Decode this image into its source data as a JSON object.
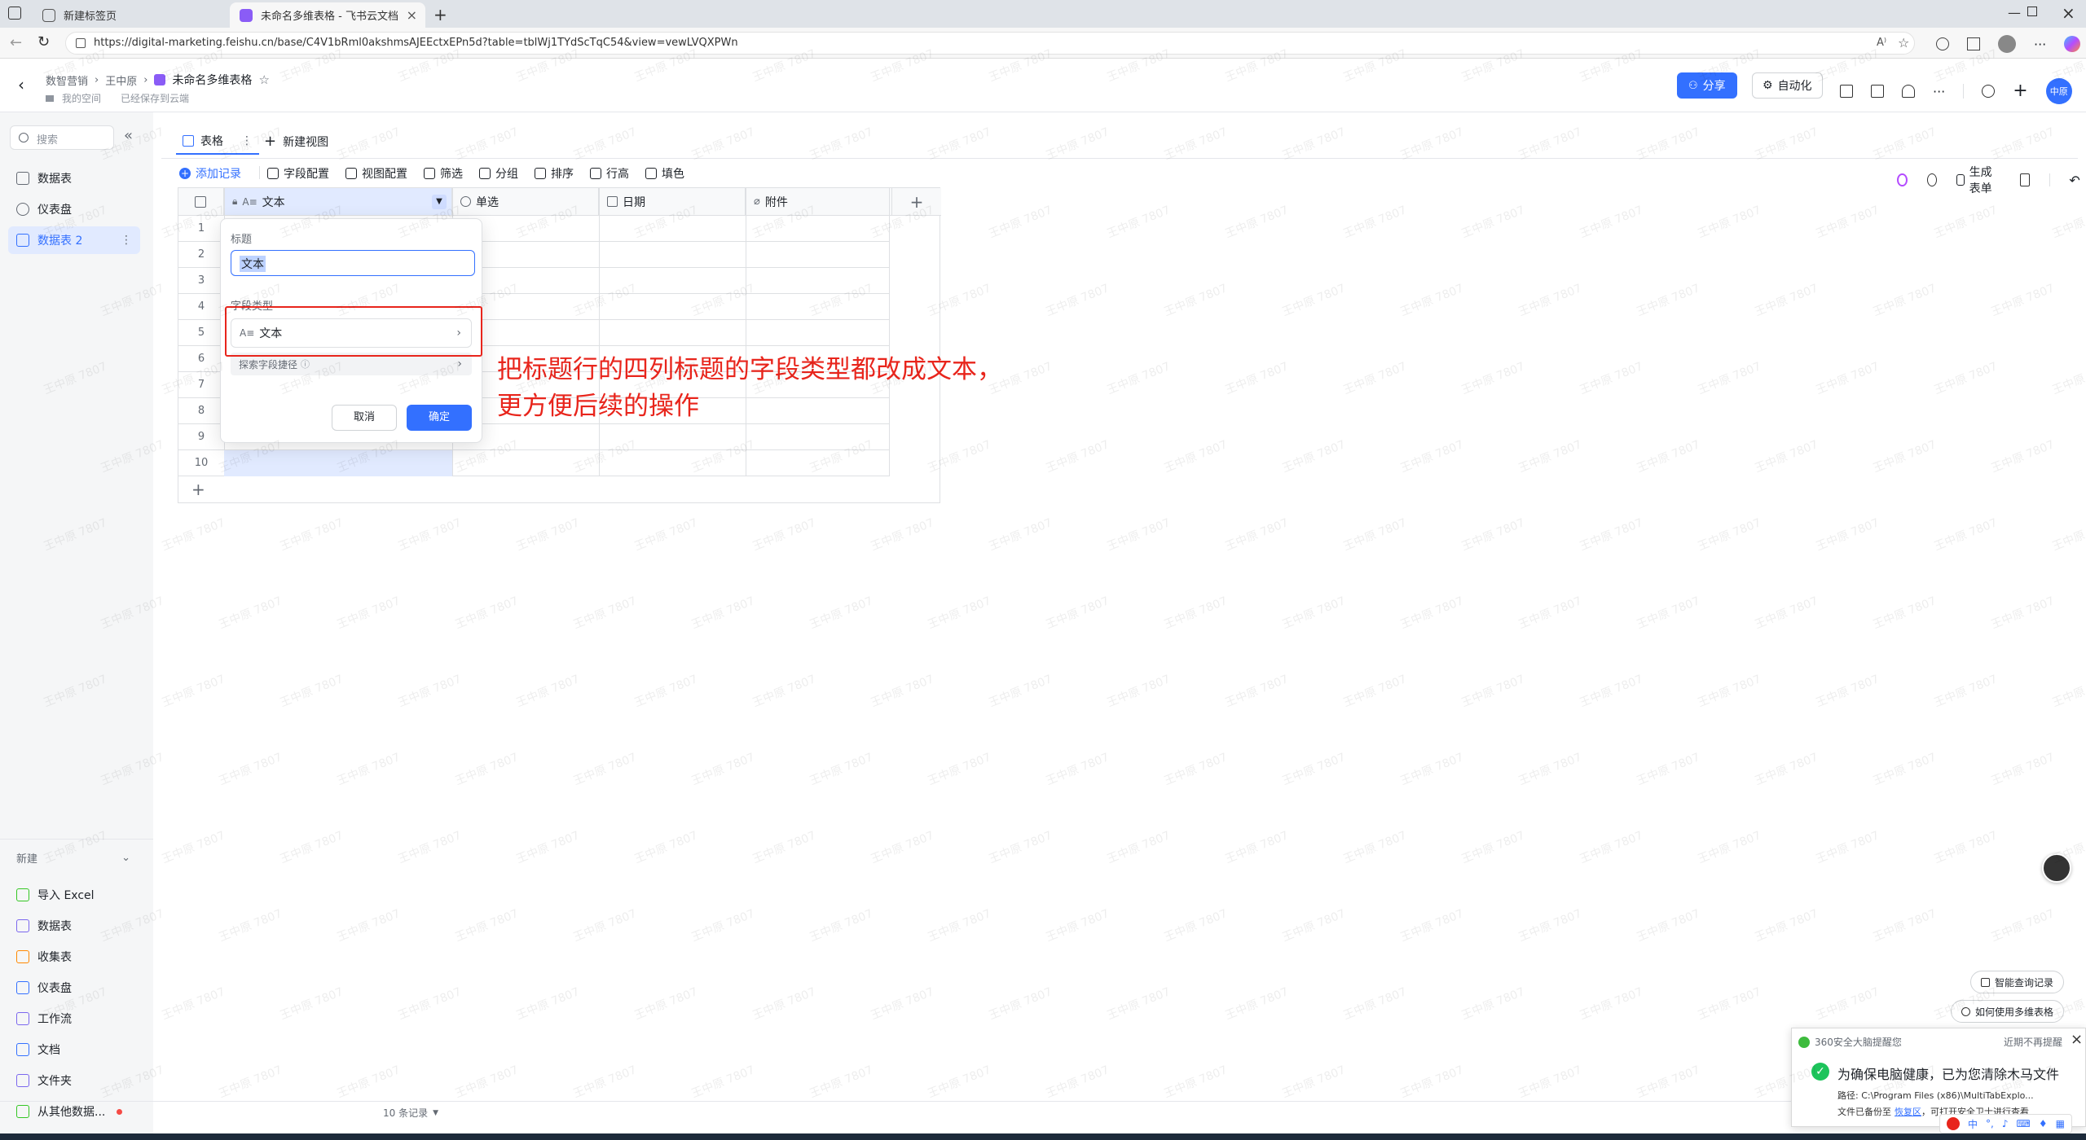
{
  "browser": {
    "tabs": [
      {
        "title": "新建标签页",
        "active": false
      },
      {
        "title": "未命名多维表格 - 飞书云文档",
        "active": true
      }
    ],
    "url": "https://digital-marketing.feishu.cn/base/C4V1bRml0akshmsAJEEctxEPn5d?table=tblWj1TYdScTqC54&view=vewLVQXPWn"
  },
  "header": {
    "breadcrumb": [
      "数智营销",
      "王中原"
    ],
    "doc_title": "未命名多维表格",
    "space": "我的空间",
    "save_status": "已经保存到云端",
    "share_label": "分享",
    "automation_label": "自动化",
    "avatar_text": "中原"
  },
  "sidebar": {
    "search_placeholder": "搜索",
    "items": [
      {
        "label": "数据表",
        "active": false
      },
      {
        "label": "仪表盘",
        "active": false
      },
      {
        "label": "数据表 2",
        "active": true
      }
    ],
    "new_section": "新建",
    "new_items": [
      {
        "label": "导入 Excel",
        "color": "#34c724"
      },
      {
        "label": "数据表",
        "color": "#7b67ee"
      },
      {
        "label": "收集表",
        "color": "#ff8800"
      },
      {
        "label": "仪表盘",
        "color": "#3370ff"
      },
      {
        "label": "工作流",
        "color": "#7b67ee"
      },
      {
        "label": "文档",
        "color": "#3370ff"
      },
      {
        "label": "文件夹",
        "color": "#7b67ee"
      },
      {
        "label": "从其他数据...",
        "color": "#34c724"
      }
    ]
  },
  "view_tabs": {
    "current": "表格",
    "new_view": "新建视图"
  },
  "toolbar": {
    "add_record": "添加记录",
    "items": [
      "字段配置",
      "视图配置",
      "筛选",
      "分组",
      "排序",
      "行高",
      "填色"
    ],
    "generate_form": "生成表单"
  },
  "grid": {
    "columns": [
      "文本",
      "单选",
      "日期",
      "附件"
    ],
    "row_numbers": [
      "1",
      "2",
      "3",
      "4",
      "5",
      "6",
      "7",
      "8",
      "9",
      "10"
    ],
    "record_count": "10 条记录"
  },
  "popup": {
    "title_label": "标题",
    "title_value": "文本",
    "field_type_label": "字段类型",
    "field_type_value": "文本",
    "explore_label": "探索字段捷径",
    "cancel": "取消",
    "confirm": "确定"
  },
  "annotation": {
    "line1": "把标题行的四列标题的字段类型都改成文本，",
    "line2": "更方便后续的操作"
  },
  "float_buttons": {
    "smart_query": "智能查询记录",
    "how_to": "如何使用多维表格"
  },
  "notification": {
    "source": "360安全大脑提醒您",
    "dismiss": "近期不再提醒",
    "headline": "为确保电脑健康，已为您清除木马文件",
    "path": "路径: C:\\Program Files (x86)\\MultiTabExplo...",
    "backup_prefix": "文件已备份至",
    "backup_link": "恢复区",
    "backup_suffix": "，可打开安全卫士进行查看"
  },
  "watermark": "王中原 7807",
  "colors": {
    "accent": "#3370ff",
    "annotation": "#e8251c"
  }
}
